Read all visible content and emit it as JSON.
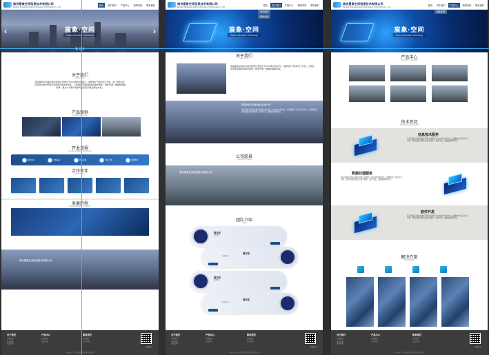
{
  "company": {
    "name_cn": "南京星象空间信息技术有限公司",
    "name_en": "Nanjing Xingxiang Space Information Technology Co., Ltd"
  },
  "nav": {
    "items": [
      "首页",
      "关于我们",
      "产品中心",
      "新闻动态",
      "联系我们"
    ],
    "dropdown": [
      "技术支持",
      "解决方案",
      "发展历程"
    ]
  },
  "hero": {
    "title": "宸象·空间",
    "subtitle": "Space Information Technology"
  },
  "panel1": {
    "about": {
      "title": "关于我们",
      "sub": "ABOUT US",
      "text": "南京星象空间信息技术有限公司成立于2019年05月08日，注册地位于南京市江宁区，是一家专注于空间信息技术研发与应用的高新技术企业。公司经营范围包括信息技术服务、软件开发、数据处理服务等，致力于为客户提供专业的空间信息解决方案。"
    },
    "products": {
      "title": "产品案例",
      "sub": "PRODUCT CASE"
    },
    "process": {
      "title": "开发流程",
      "sub": "DEVELOPMENT PROCESS",
      "steps": [
        "需求分析",
        "方案设计",
        "开发实施",
        "测试上线",
        "运营维护"
      ]
    },
    "partners": {
      "title": "合作伙伴",
      "sub": "PARTNERS"
    },
    "history": {
      "title": "发展历程",
      "sub": "DEVELOPMENT HISTORY"
    },
    "banner_text": "南京星象空间信息技术有限公司"
  },
  "panel2": {
    "about": {
      "title": "关于我们",
      "sub": "ABOUT US"
    },
    "intro_title": "南京星象空间信息技术有限公司",
    "intro_text": "南京星象空间信息技术有限公司成立于2019年05月08日，注册地位于南京市江宁区。公司经营范围包括信息技术服务、软件开发、数据处理服务等。",
    "culture": {
      "title": "公司愿景",
      "sub": "COMPANY VISION"
    },
    "banner_text": "南京星象空间信息技术有限公司",
    "team": {
      "title": "团队介绍",
      "sub": "TEAM",
      "members": [
        {
          "name": "周华东",
          "role": "总经理"
        },
        {
          "name": "周华东",
          "role": "技术总监"
        },
        {
          "name": "周华东",
          "role": "总经理"
        },
        {
          "name": "周华东",
          "role": "技术总监"
        }
      ]
    }
  },
  "panel3": {
    "products": {
      "title": "产品中心",
      "sub": "PRODUCT CENTER"
    },
    "tech": {
      "title": "技术支持",
      "sub": "TECHNICAL SUPPORT"
    },
    "services": [
      {
        "title": "信息技术服务",
        "text": "南京星象空间信息技术有限公司成立于2019年05月08日，注册地位于南京市江宁区，经营范围包括信息技术服务、软件开发、数据处理服务等。"
      },
      {
        "title": "数据处理服务",
        "text": "南京星象空间信息技术有限公司成立于2019年05月08日，注册地位于南京市江宁区，经营范围包括信息技术服务、软件开发、数据处理服务等。"
      },
      {
        "title": "软件开发",
        "text": "南京星象空间信息技术有限公司成立于2019年05月08日，注册地位于南京市江宁区，经营范围包括信息技术服务、软件开发、数据处理服务等。"
      }
    ],
    "solutions": {
      "title": "解决方案",
      "sub": "SOLUTIONS"
    }
  },
  "footer": {
    "col1_title": "关于我们",
    "col2_title": "产品中心",
    "col3_title": "联系我们",
    "links": [
      "公司简介",
      "企业文化",
      "发展历程"
    ],
    "qr_label": "扫码关注",
    "copyright": "Copyright © 南京星象空间信息技术有限公司"
  },
  "colors": {
    "primary": "#1d4f8c",
    "footer": "#3c3c3c",
    "guide": "#39b6ff"
  }
}
